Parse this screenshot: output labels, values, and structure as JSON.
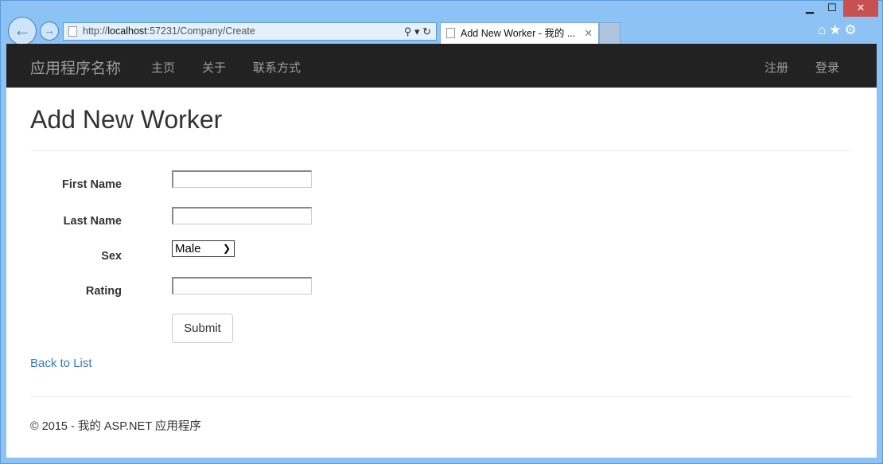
{
  "window": {
    "minimize": "▁",
    "maximize": "☐",
    "close": "✕"
  },
  "browser": {
    "back_icon": "back-arrow",
    "address_prefix": "http://",
    "address_host": "localhost",
    "address_rest": ":57231/Company/Create",
    "address_tools": "⚲ ▾  ↻",
    "tab_title": "Add New Worker - 我的 ...",
    "tab_close": "✕",
    "right_icons": "⌂★⚙"
  },
  "navbar": {
    "brand": "应用程序名称",
    "links": [
      "主页",
      "关于",
      "联系方式"
    ],
    "right": [
      "注册",
      "登录"
    ]
  },
  "main": {
    "title": "Add New Worker",
    "fields": [
      {
        "label": "First Name",
        "value": ""
      },
      {
        "label": "Last Name",
        "value": ""
      },
      {
        "label": "Sex",
        "value": "Male"
      },
      {
        "label": "Rating",
        "value": ""
      }
    ],
    "submit": "Submit",
    "back_link": "Back to List"
  },
  "footer": "© 2015 - 我的 ASP.NET 应用程序"
}
